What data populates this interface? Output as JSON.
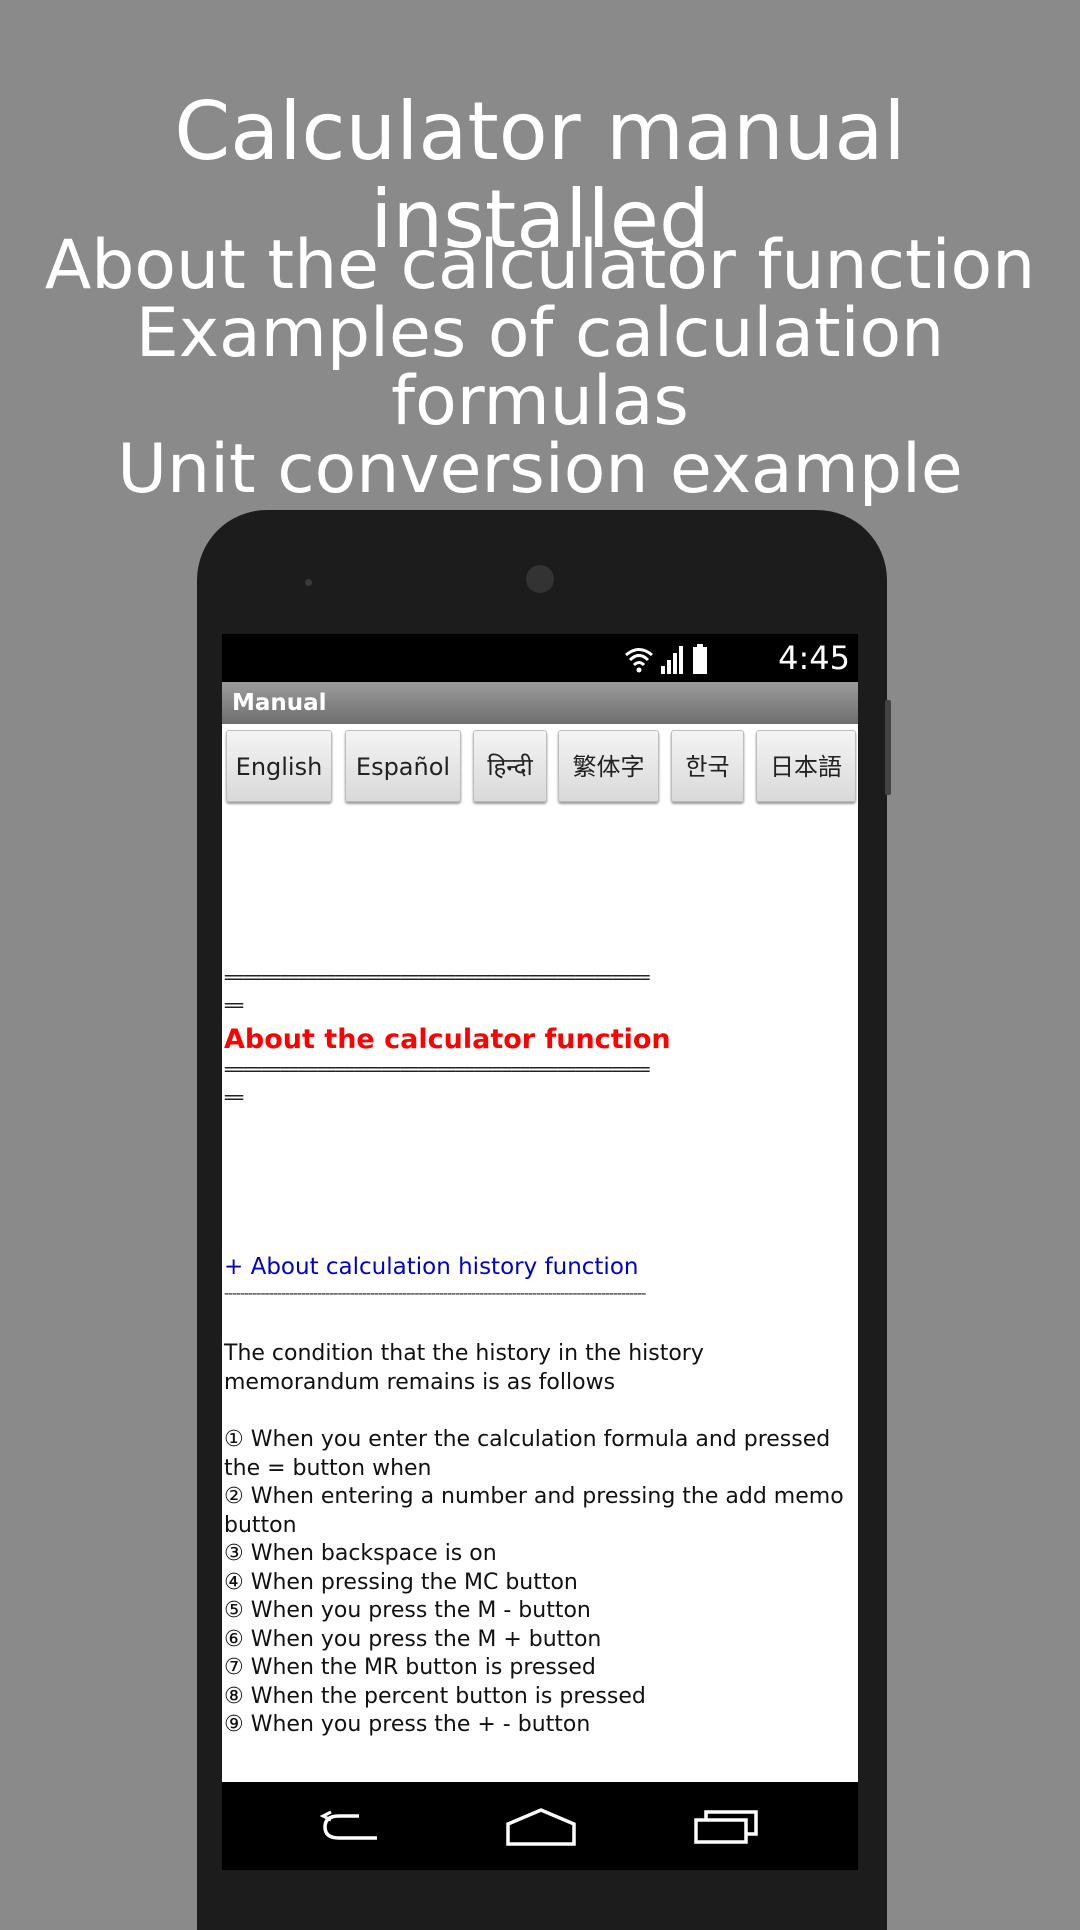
{
  "promo": {
    "title": "Calculator manual installed",
    "lines": [
      "About the calculator function",
      "Examples of calculation formulas",
      "Unit conversion example"
    ]
  },
  "status_bar": {
    "time": "4:45",
    "icons": [
      "wifi-icon",
      "signal-icon",
      "battery-icon"
    ]
  },
  "app": {
    "title": "Manual",
    "languages": [
      "English",
      "Español",
      "हिन्दी",
      "繁体字",
      "한국",
      "日本語"
    ]
  },
  "content": {
    "separator_line1": "==============================================",
    "separator_line2": "==",
    "section_title": "About the calculator function",
    "link": "+ About calculation history function",
    "dash_line": "--------------------------------------------------------------------------------------------------------",
    "intro": "The condition that the history in the history memorandum remains is as follows",
    "conditions": [
      "① When you enter the calculation formula and pressed the = button when",
      "② When entering a number and pressing the add memo button",
      "③ When backspace is on",
      "④ When pressing the MC button",
      "⑤ When you press the M - button",
      "⑥ When you press the M + button",
      "⑦ When the MR button is pressed",
      "⑧ When the percent button is pressed",
      "⑨ When you press the + - button"
    ]
  },
  "navigation": {
    "icons": [
      "back-icon",
      "home-icon",
      "recent-apps-icon"
    ]
  },
  "colors": {
    "background": "#8a8a8a",
    "section_title": "#ff0000",
    "link": "#0000cc"
  }
}
